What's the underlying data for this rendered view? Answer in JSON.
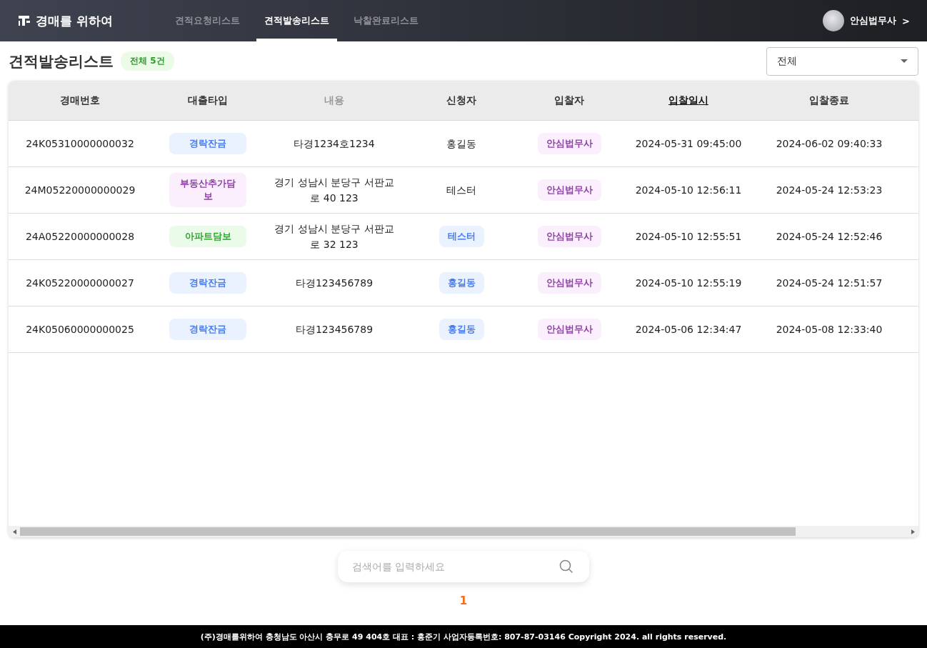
{
  "header": {
    "logo": "경매를 위하여",
    "nav": [
      {
        "label": "견적요청리스트",
        "selected": false
      },
      {
        "label": "견적발송리스트",
        "selected": true
      },
      {
        "label": "낙찰완료리스트",
        "selected": false
      }
    ],
    "user": {
      "name": "안심법무사",
      "chevron": ">"
    }
  },
  "title": "견적발송리스트",
  "count_badge": "전체 5건",
  "filter": {
    "value": "전체"
  },
  "table": {
    "columns": [
      {
        "label": "경매번호",
        "kind": "normal"
      },
      {
        "label": "대출타입",
        "kind": "normal"
      },
      {
        "label": "내용",
        "kind": "muted"
      },
      {
        "label": "신청자",
        "kind": "normal"
      },
      {
        "label": "입찰자",
        "kind": "normal"
      },
      {
        "label": "입찰일시",
        "kind": "sorted"
      },
      {
        "label": "입찰종료",
        "kind": "normal"
      }
    ],
    "rows": [
      {
        "number": "24K05310000000032",
        "loan_type": {
          "label": "경락잔금",
          "color": "#4a7cf0"
        },
        "content": "타경1234호1234",
        "applicant": {
          "label": "홍길동",
          "kind": "text"
        },
        "bidder": {
          "label": "안심법무사",
          "color": "#8e3fa8"
        },
        "bid_time": "2024-05-31 09:45:00",
        "bid_end": "2024-06-02 09:40:33"
      },
      {
        "number": "24M05220000000029",
        "loan_type": {
          "label": "부동산추가담보",
          "color": "#8e3fa8"
        },
        "content": "경기 성남시 분당구 서판교로 40 123",
        "applicant": {
          "label": "테스터",
          "kind": "text"
        },
        "bidder": {
          "label": "안심법무사",
          "color": "#8e3fa8"
        },
        "bid_time": "2024-05-10 12:56:11",
        "bid_end": "2024-05-24 12:53:23"
      },
      {
        "number": "24A05220000000028",
        "loan_type": {
          "label": "아파트담보",
          "color": "#2ea82e"
        },
        "content": "경기 성남시 분당구 서판교로 32 123",
        "applicant": {
          "label": "테스터",
          "kind": "tag"
        },
        "bidder": {
          "label": "안심법무사",
          "color": "#8e3fa8"
        },
        "bid_time": "2024-05-10 12:55:51",
        "bid_end": "2024-05-24 12:52:46"
      },
      {
        "number": "24K05220000000027",
        "loan_type": {
          "label": "경락잔금",
          "color": "#4a7cf0"
        },
        "content": "타경123456789",
        "applicant": {
          "label": "홍길동",
          "kind": "tag"
        },
        "bidder": {
          "label": "안심법무사",
          "color": "#8e3fa8"
        },
        "bid_time": "2024-05-10 12:55:19",
        "bid_end": "2024-05-24 12:51:57"
      },
      {
        "number": "24K05060000000025",
        "loan_type": {
          "label": "경락잔금",
          "color": "#4a7cf0"
        },
        "content": "타경123456789",
        "applicant": {
          "label": "홍길동",
          "kind": "tag"
        },
        "bidder": {
          "label": "안심법무사",
          "color": "#8e3fa8"
        },
        "bid_time": "2024-05-06 12:34:47",
        "bid_end": "2024-05-08 12:33:40"
      }
    ]
  },
  "search": {
    "placeholder": "검색어를 입력하세요"
  },
  "pages": [
    {
      "label": "1",
      "selected": true
    }
  ],
  "footer": "(주)경매를위하여 충청남도 아산시 충무로 49 404호 대표 : 홍준기 사업자등록번호: 807-87-03146 Copyright 2024. all rights reserved."
}
